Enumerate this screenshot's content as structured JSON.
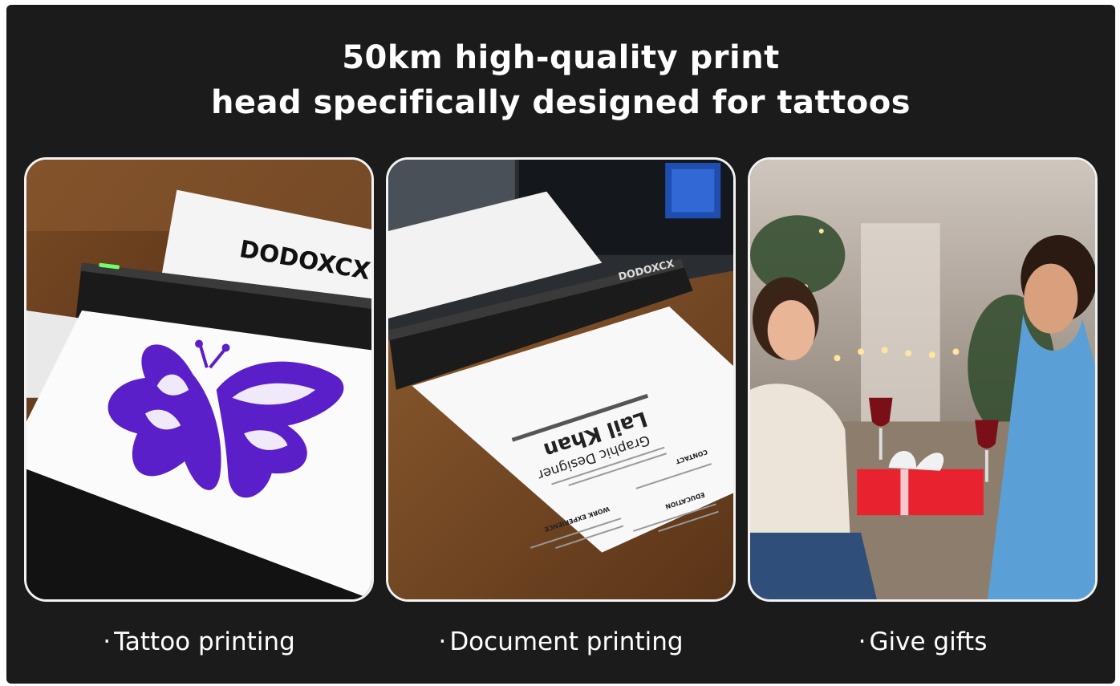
{
  "headline": {
    "line1": "50km high-quality print",
    "line2": "head specifically designed for tattoos"
  },
  "cards": [
    {
      "printer_brand": "DODOXCX",
      "caption": "Tattoo printing",
      "bullet": "·"
    },
    {
      "printer_brand": "DODOXCX",
      "caption": "Document printing",
      "bullet": "·",
      "resume_name": "Lail Khan",
      "resume_role": "Graphic Designer",
      "resume_section_1": "WORK EXPERIENCE",
      "resume_section_2": "EDUCATION",
      "resume_section_3": "CONTACT"
    },
    {
      "caption": "Give gifts",
      "bullet": "·"
    }
  ],
  "colors": {
    "background": "#1b1b1b",
    "text": "#ffffff",
    "card_border": "#f2f2f2",
    "butterfly": "#5b1fc9",
    "gift": "#e8232f"
  }
}
